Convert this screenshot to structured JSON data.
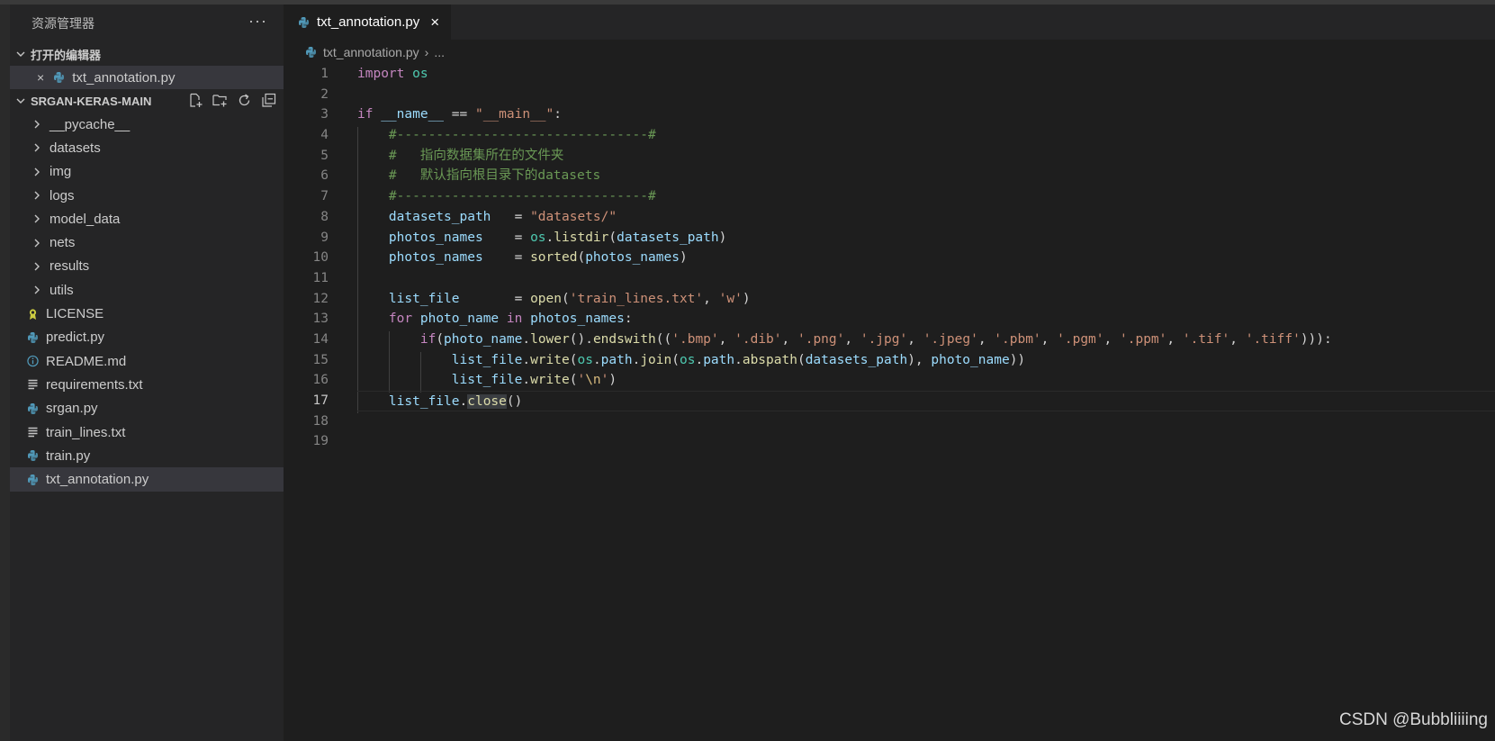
{
  "sidebar": {
    "title": "资源管理器",
    "more_label": "···",
    "open_editors": {
      "header": "打开的编辑器",
      "item": {
        "close": "×",
        "label": "txt_annotation.py"
      }
    },
    "project": {
      "header": "SRGAN-KERAS-MAIN",
      "items": [
        {
          "label": "__pycache__",
          "kind": "folder"
        },
        {
          "label": "datasets",
          "kind": "folder"
        },
        {
          "label": "img",
          "kind": "folder"
        },
        {
          "label": "logs",
          "kind": "folder"
        },
        {
          "label": "model_data",
          "kind": "folder"
        },
        {
          "label": "nets",
          "kind": "folder"
        },
        {
          "label": "results",
          "kind": "folder"
        },
        {
          "label": "utils",
          "kind": "folder"
        },
        {
          "label": "LICENSE",
          "kind": "license",
          "icon": "license-icon"
        },
        {
          "label": "predict.py",
          "kind": "python",
          "icon": "python-icon"
        },
        {
          "label": "README.md",
          "kind": "info",
          "icon": "info-icon"
        },
        {
          "label": "requirements.txt",
          "kind": "text",
          "icon": "text-file-icon"
        },
        {
          "label": "srgan.py",
          "kind": "python",
          "icon": "python-icon"
        },
        {
          "label": "train_lines.txt",
          "kind": "text",
          "icon": "text-file-icon"
        },
        {
          "label": "train.py",
          "kind": "python",
          "icon": "python-icon"
        },
        {
          "label": "txt_annotation.py",
          "kind": "python",
          "icon": "python-icon",
          "selected": true
        }
      ]
    }
  },
  "tab": {
    "label": "txt_annotation.py",
    "close": "×"
  },
  "breadcrumb": {
    "file": "txt_annotation.py",
    "sep": "›",
    "rest": "..."
  },
  "editor": {
    "active_line": 17,
    "line_numbers": [
      "1",
      "2",
      "3",
      "4",
      "5",
      "6",
      "7",
      "8",
      "9",
      "10",
      "11",
      "12",
      "13",
      "14",
      "15",
      "16",
      "17",
      "18",
      "19"
    ],
    "lines": [
      "import os",
      "",
      "if __name__ == \"__main__\":",
      "    #--------------------------------#",
      "    #   指向数据集所在的文件夹",
      "    #   默认指向根目录下的datasets",
      "    #--------------------------------#",
      "    datasets_path   = \"datasets/\"",
      "    photos_names    = os.listdir(datasets_path)",
      "    photos_names    = sorted(photos_names)",
      "",
      "    list_file       = open('train_lines.txt', 'w')",
      "    for photo_name in photos_names:",
      "        if(photo_name.lower().endswith(('.bmp', '.dib', '.png', '.jpg', '.jpeg', '.pbm', '.pgm', '.ppm', '.tif', '.tiff'))):",
      "            list_file.write(os.path.join(os.path.abspath(datasets_path), photo_name))",
      "            list_file.write('\\n')",
      "    list_file.close()",
      "",
      ""
    ]
  },
  "watermark": "CSDN @Bubbliiiing",
  "colors": {
    "keyword": "#c586c0",
    "control": "#569cd6",
    "variable": "#9cdcfe",
    "function": "#dcdcaa",
    "string": "#ce9178",
    "comment": "#6a9955",
    "module": "#4ec9b0",
    "python_icon": "#519aba",
    "license_icon": "#cbcb41"
  }
}
